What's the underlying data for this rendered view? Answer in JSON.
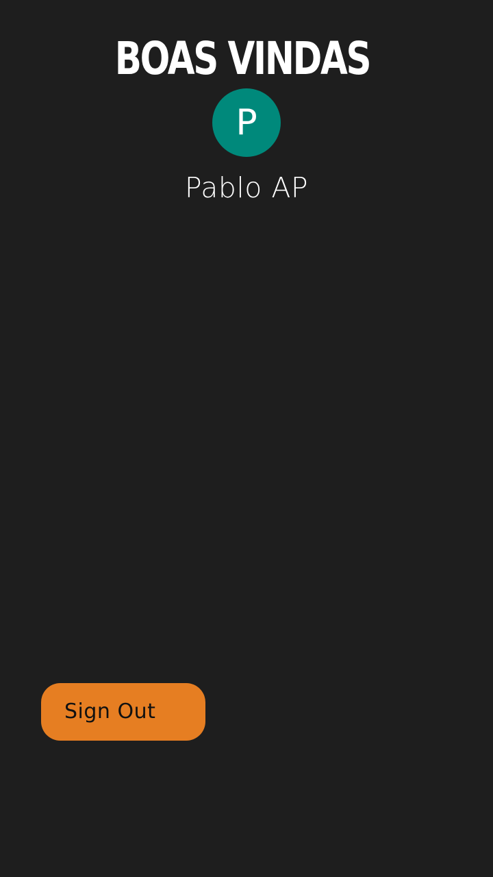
{
  "header": {
    "title": "BOAS VINDAS"
  },
  "profile": {
    "avatar_initial": "P",
    "avatar_color": "#00897b",
    "name": "Pablo AP"
  },
  "actions": {
    "signout_label": "Sign Out",
    "signout_color": "#e67e22"
  },
  "theme": {
    "background": "#1e1e1e",
    "text": "#ffffff"
  }
}
